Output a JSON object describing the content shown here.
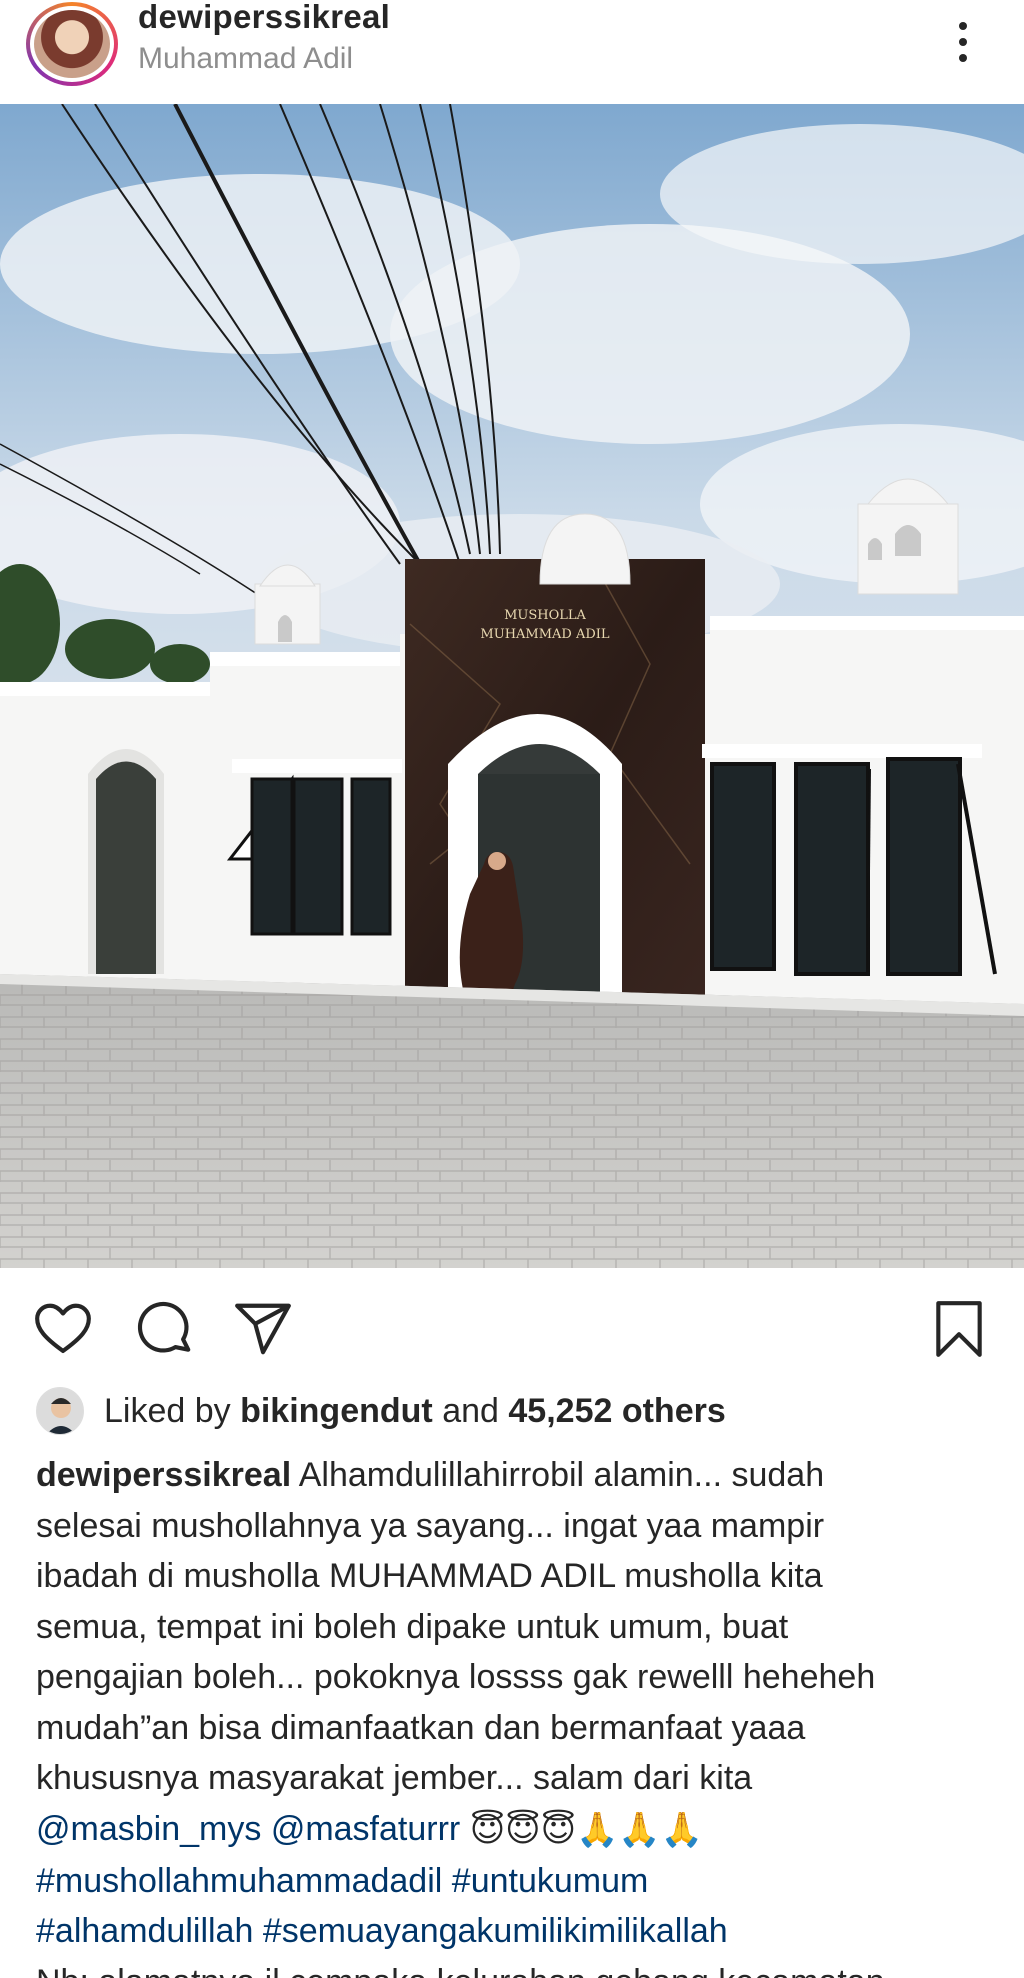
{
  "header": {
    "username": "dewiperssikreal",
    "location": "Muhammad Adil",
    "more_icon": "more-vertical-icon"
  },
  "photo": {
    "sign_line1": "MUSHOLLA",
    "sign_line2": "MUHAMMAD ADIL"
  },
  "actions": {
    "like_icon": "heart-icon",
    "comment_icon": "comment-icon",
    "share_icon": "send-icon",
    "save_icon": "bookmark-icon"
  },
  "likes": {
    "prefix": "Liked by",
    "liker": "bikingendut",
    "middle": "and",
    "count": "45,252 others"
  },
  "caption": {
    "username": "dewiperssikreal",
    "line1": "Alhamdulillahirrobil alamin... sudah",
    "line2": "selesai mushollahnya ya sayang... ingat yaa mampir",
    "line3": "ibadah di musholla MUHAMMAD ADIL musholla kita",
    "line4": "semua, tempat ini boleh dipake untuk umum, buat",
    "line5": "pengajian boleh... pokoknya lossss gak rewelll heheheh",
    "line6": "mudah”an bisa dimanfaatkan dan bermanfaat yaaa",
    "line7": "khususnya masyarakat jember... salam dari kita",
    "mention1": "@masbin_mys",
    "mention2": "@masfaturrr",
    "emojis": "😇😇😇🙏🙏🙏",
    "hashtag1": "#mushollahmuhammadadil",
    "hashtag2": "#untukumum",
    "hashtag3": "#alhamdulillah",
    "hashtag4": "#semuayangakumilikimilikallah",
    "line_last": "Nb: alamatnya jl cempaka kelurahan gebang kecamatan"
  },
  "colors": {
    "text": "#262626",
    "secondary": "#8e8e8e",
    "link": "#003569"
  }
}
